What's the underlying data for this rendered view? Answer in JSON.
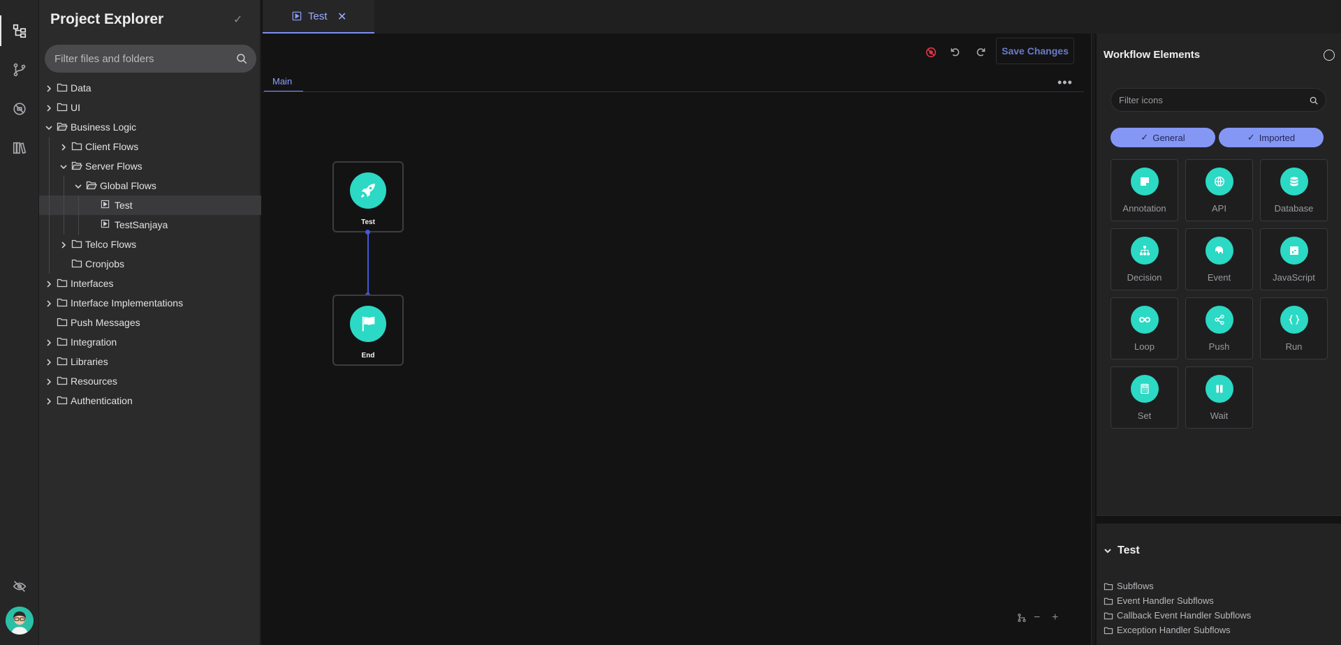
{
  "activity": {
    "items": [
      {
        "name": "project-explorer-icon"
      },
      {
        "name": "source-control-icon"
      },
      {
        "name": "blocked-icon"
      },
      {
        "name": "library-icon"
      }
    ],
    "bottom_icon": "eye-off-icon"
  },
  "explorer": {
    "title": "Project Explorer",
    "search_placeholder": "Filter files and folders",
    "tree": [
      {
        "label": "Data",
        "depth": 0,
        "expandable": true,
        "expanded": false,
        "type": "folder"
      },
      {
        "label": "UI",
        "depth": 0,
        "expandable": true,
        "expanded": false,
        "type": "folder"
      },
      {
        "label": "Business Logic",
        "depth": 0,
        "expandable": true,
        "expanded": true,
        "type": "folder-open"
      },
      {
        "label": "Client Flows",
        "depth": 1,
        "expandable": true,
        "expanded": false,
        "type": "folder"
      },
      {
        "label": "Server Flows",
        "depth": 1,
        "expandable": true,
        "expanded": true,
        "type": "folder-open"
      },
      {
        "label": "Global Flows",
        "depth": 2,
        "expandable": true,
        "expanded": true,
        "type": "folder-open"
      },
      {
        "label": "Test",
        "depth": 3,
        "expandable": false,
        "type": "flow",
        "selected": true
      },
      {
        "label": "TestSanjaya",
        "depth": 3,
        "expandable": false,
        "type": "flow"
      },
      {
        "label": "Telco Flows",
        "depth": 1,
        "expandable": true,
        "expanded": false,
        "type": "folder"
      },
      {
        "label": "Cronjobs",
        "depth": 1,
        "expandable": false,
        "type": "folder"
      },
      {
        "label": "Interfaces",
        "depth": 0,
        "expandable": true,
        "expanded": false,
        "type": "folder"
      },
      {
        "label": "Interface Implementations",
        "depth": 0,
        "expandable": true,
        "expanded": false,
        "type": "folder"
      },
      {
        "label": "Push Messages",
        "depth": 0,
        "expandable": false,
        "type": "folder"
      },
      {
        "label": "Integration",
        "depth": 0,
        "expandable": true,
        "expanded": false,
        "type": "folder"
      },
      {
        "label": "Libraries",
        "depth": 0,
        "expandable": true,
        "expanded": false,
        "type": "folder"
      },
      {
        "label": "Resources",
        "depth": 0,
        "expandable": true,
        "expanded": false,
        "type": "folder"
      },
      {
        "label": "Authentication",
        "depth": 0,
        "expandable": true,
        "expanded": false,
        "type": "folder"
      }
    ]
  },
  "tabs": [
    {
      "label": "Test",
      "icon": "flow-file-icon",
      "active": true,
      "close": "✕"
    }
  ],
  "editor": {
    "save_label": "Save Changes",
    "subtabs": [
      {
        "label": "Main",
        "active": true
      }
    ],
    "more": "•••",
    "nodes": [
      {
        "label": "Test",
        "icon": "rocket-icon"
      },
      {
        "label": "End",
        "icon": "flag-icon"
      }
    ],
    "zoom_out": "−",
    "zoom_in": "+"
  },
  "elements_panel": {
    "title": "Workflow Elements",
    "search_placeholder": "Filter icons",
    "filters": [
      {
        "label": "General",
        "checked": true
      },
      {
        "label": "Imported",
        "checked": true
      }
    ],
    "items": [
      {
        "label": "Annotation",
        "icon": "note-icon"
      },
      {
        "label": "API",
        "icon": "globe-icon"
      },
      {
        "label": "Database",
        "icon": "database-icon"
      },
      {
        "label": "Decision",
        "icon": "sitemap-icon"
      },
      {
        "label": "Event",
        "icon": "elephant-icon"
      },
      {
        "label": "JavaScript",
        "icon": "code-file-icon"
      },
      {
        "label": "Loop",
        "icon": "infinity-icon"
      },
      {
        "label": "Push",
        "icon": "share-icon"
      },
      {
        "label": "Run",
        "icon": "braces-icon"
      },
      {
        "label": "Set",
        "icon": "calculator-icon"
      },
      {
        "label": "Wait",
        "icon": "pause-icon"
      }
    ]
  },
  "outline": {
    "title": "Test",
    "items": [
      "Subflows",
      "Event Handler Subflows",
      "Callback Event Handler Subflows",
      "Exception Handler Subflows"
    ]
  },
  "colors": {
    "accent": "#7d8ff0",
    "node": "#2bd9c4",
    "edge": "#4458d8",
    "danger": "#e0354a"
  }
}
